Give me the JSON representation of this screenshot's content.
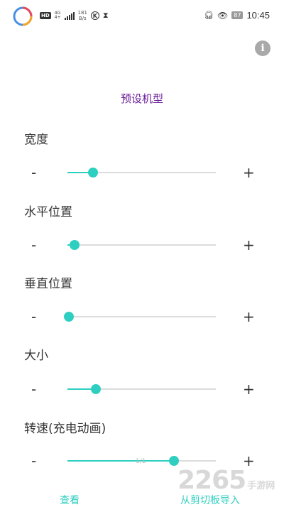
{
  "status_bar": {
    "hd": "HD",
    "net_type": "4G",
    "net_sub": "4+",
    "speed_value": "181",
    "speed_unit": "B/s",
    "k_badge": "K",
    "battery": "87",
    "time": "10:45"
  },
  "page": {
    "preset_label": "预设机型",
    "minus_label": "-",
    "plus_label": "+"
  },
  "sliders": [
    {
      "label": "宽度",
      "fraction": 0.17
    },
    {
      "label": "水平位置",
      "fraction": 0.05
    },
    {
      "label": "垂直位置",
      "fraction": 0.01
    },
    {
      "label": "大小",
      "fraction": 0.19
    },
    {
      "label": "转速(充电动画)",
      "fraction": 0.72
    }
  ],
  "overlay_text": "1/1",
  "bottom_buttons": {
    "view": "查看",
    "import_clipboard": "从剪切板导入"
  },
  "watermark": {
    "number": "2265",
    "text": "手游网"
  },
  "colors": {
    "accent": "#2ecfc0",
    "preset": "#6a1b9a",
    "track": "#dcdcdc",
    "info": "#a9a9a9"
  }
}
